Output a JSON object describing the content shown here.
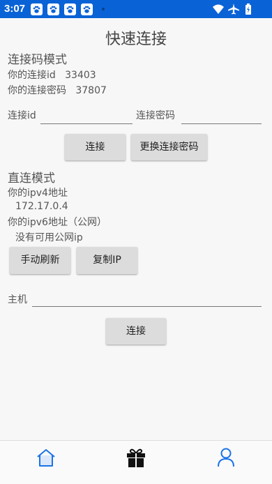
{
  "status_bar": {
    "time": "3:07",
    "icons": [
      "paw-notification-icon",
      "paw-notification-icon",
      "paw-notification-icon",
      "paw-notification-icon",
      "wifi-icon",
      "airplane-mode-icon",
      "battery-icon"
    ],
    "background": "#0a63d6"
  },
  "page": {
    "title": "快速连接"
  },
  "code_mode": {
    "heading": "连接码模式",
    "id_line": "你的连接id   33403",
    "password_line": "你的连接密码   37807",
    "id_label": "连接id",
    "id_value": "",
    "password_label": "连接密码",
    "password_value": "",
    "connect_button": "连接",
    "change_password_button": "更换连接密码"
  },
  "direct_mode": {
    "heading": "直连模式",
    "ipv4_label": "你的ipv4地址",
    "ipv4_value": "172.17.0.4",
    "ipv6_label": "你的ipv6地址（公网）",
    "ipv6_value": "没有可用公网ip",
    "refresh_button": "手动刷新",
    "copy_ip_button": "复制IP",
    "host_label": "主机",
    "host_value": "",
    "connect_button": "连接"
  },
  "bottom_nav": {
    "items": [
      {
        "icon": "home-icon",
        "active": true
      },
      {
        "icon": "gift-icon",
        "active": false
      },
      {
        "icon": "user-icon",
        "active": false
      }
    ],
    "accent": "#1a73e8"
  }
}
